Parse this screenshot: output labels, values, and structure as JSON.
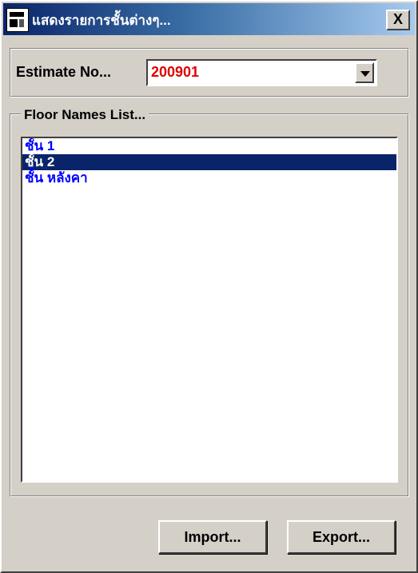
{
  "window": {
    "title": "แสดงรายการชั้นต่างๆ...",
    "close_label": "X"
  },
  "estimate": {
    "label": "Estimate No...",
    "value": "200901"
  },
  "floors": {
    "caption": "Floor Names List...",
    "items": [
      {
        "label": "ชั้น 1"
      },
      {
        "label": "ชั้น 2"
      },
      {
        "label": "ชั้น หลังคา"
      }
    ],
    "selected_index": 1
  },
  "buttons": {
    "import_label": "Import...",
    "export_label": "Export..."
  },
  "colors": {
    "title_bar": "#0a246a",
    "selection": "#0a246a",
    "list_text": "#0000ff",
    "estimate_value": "#e00000",
    "dialog_face": "#d4d0c8"
  }
}
